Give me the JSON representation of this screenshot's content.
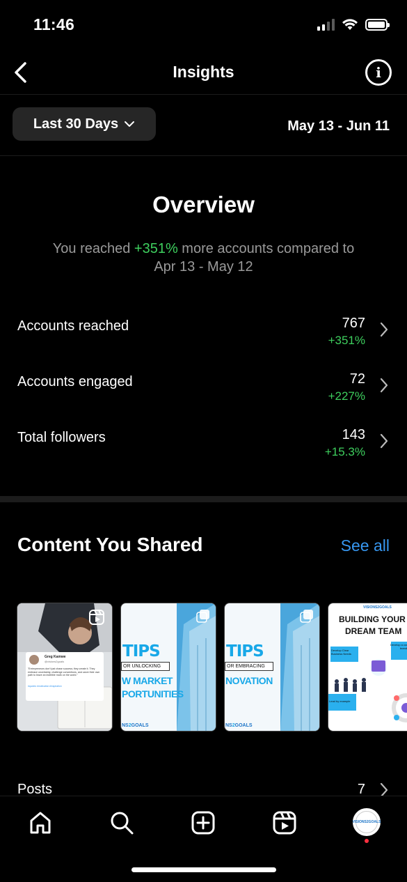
{
  "status": {
    "time": "11:46"
  },
  "header": {
    "title": "Insights"
  },
  "range": {
    "selected": "Last 30 Days",
    "dates": "May 13 - Jun 11"
  },
  "overview": {
    "title": "Overview",
    "sub_prefix": "You reached ",
    "sub_change": "+351%",
    "sub_suffix": " more accounts compared to",
    "sub_compare": "Apr 13 - May 12",
    "metrics": [
      {
        "label": "Accounts reached",
        "value": "767",
        "change": "+351%"
      },
      {
        "label": "Accounts engaged",
        "value": "72",
        "change": "+227%"
      },
      {
        "label": "Total followers",
        "value": "143",
        "change": "+15.3%"
      }
    ]
  },
  "content": {
    "title": "Content You Shared",
    "see_all": "See all",
    "thumbnails": [
      {
        "type": "reel",
        "quote_name": "Greg Kamwe",
        "quote_handle": "@visions2goals",
        "quote_text": "\"Entrepreneurs don't just chase success; they create it. They embrace uncertainty, challenge conventions, and carve their own path to leave an indelible mark on the world.\"",
        "quote_tags": "#quotes #motivation #inspiration"
      },
      {
        "type": "carousel",
        "headline": "TIPS",
        "band": "OR UNLOCKING",
        "line1": "W MARKET",
        "line2": "PORTUNITIES",
        "brand": "NS",
        "brand2": "GOALS"
      },
      {
        "type": "carousel",
        "headline": "TIPS",
        "band": "OR EMBRACING",
        "line1": "NOVATION",
        "line2": "",
        "brand": "NS",
        "brand2": "GOALS"
      },
      {
        "type": "post",
        "brand": "VISIONS2GOALS",
        "title1": "BUILDING YOUR",
        "title2": "DREAM TEAM",
        "note1": "Develop a compelling brand",
        "note2": "Develop Clear Business Needs",
        "note3": "Lead by example"
      }
    ]
  },
  "posts": {
    "label": "Posts",
    "value": "7"
  },
  "tabbar": {
    "profile_text": "VISIONS2GOALS"
  },
  "colors": {
    "accent_blue": "#3797f0",
    "positive_green": "#3ecf5e",
    "notification_red": "#ff3040"
  },
  "icons": [
    "chevron-left-icon",
    "info-icon",
    "chevron-down-icon",
    "chevron-right-icon",
    "reel-icon",
    "carousel-icon",
    "home-icon",
    "search-icon",
    "create-icon",
    "reels-icon",
    "profile-avatar"
  ]
}
